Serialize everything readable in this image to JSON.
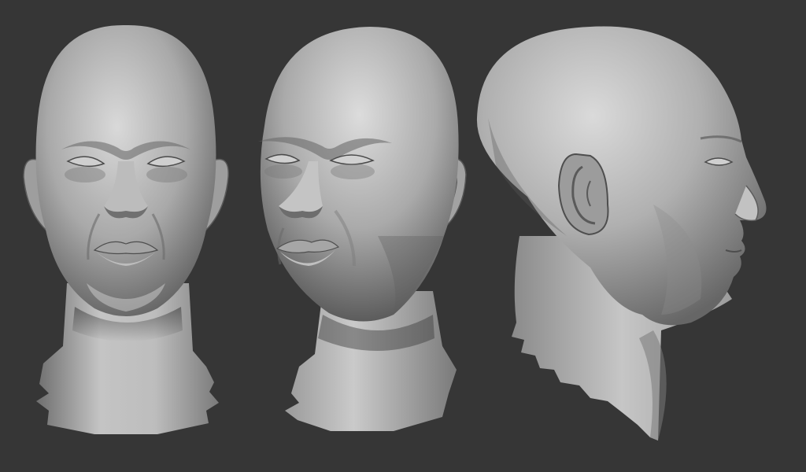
{
  "scene": {
    "background_color": "#363636",
    "clay_color": "#b8b8b8",
    "views": [
      {
        "name": "front",
        "icon": "head-front-view"
      },
      {
        "name": "three-quarter",
        "icon": "head-three-quarter-view"
      },
      {
        "name": "profile",
        "icon": "head-side-profile-view"
      }
    ]
  }
}
